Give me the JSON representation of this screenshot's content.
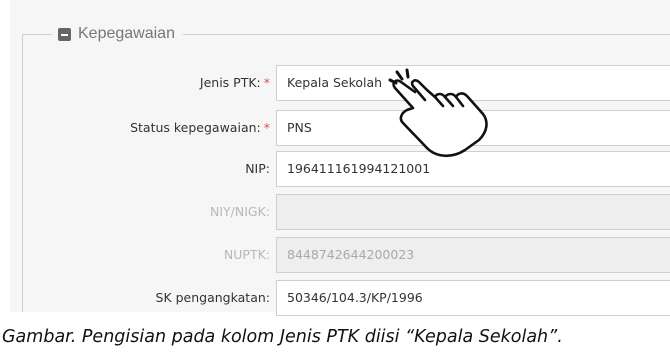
{
  "fieldset": {
    "legend": "Kepegawaian",
    "icon": "collapse-minus-icon"
  },
  "fields": [
    {
      "label": "Jenis PTK:",
      "required": true,
      "value": "Kepala Sekolah",
      "disabled": false
    },
    {
      "label": "Status kepegawaian:",
      "required": true,
      "value": "PNS",
      "disabled": false
    },
    {
      "label": "NIP:",
      "required": false,
      "value": "196411161994121001",
      "disabled": false
    },
    {
      "label": "NIY/NIGK:",
      "required": false,
      "value": "",
      "disabled": true
    },
    {
      "label": "NUPTK:",
      "required": false,
      "value": "8448742644200023",
      "disabled": true
    },
    {
      "label": "SK pengangkatan:",
      "required": false,
      "value": "50346/104.3/KP/1996",
      "disabled": false
    }
  ],
  "required_mark": "*",
  "caption": "Gambar. Pengisian pada kolom Jenis PTK diisi “Kepala Sekolah”.",
  "cursor_icon": "hand-pointer-icon",
  "colors": {
    "required": "#d9534f",
    "panel": "#f6f6f6",
    "disabled_field": "#eeeeee"
  }
}
